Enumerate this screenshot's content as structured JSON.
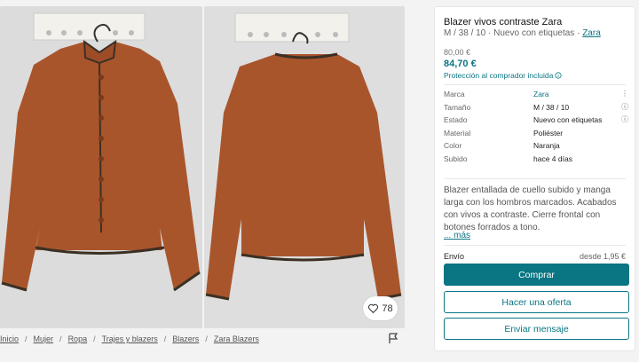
{
  "listing": {
    "title": "Blazer vivos contraste Zara",
    "subtitle": "M / 38 / 10 · Nuevo con etiquetas · ",
    "brand_link": "Zara",
    "old_price": "80,00 €",
    "price": "84,70 €",
    "protection": "Protección al comprador incluida"
  },
  "details": [
    {
      "key": "Marca",
      "value": "Zara",
      "link": true
    },
    {
      "key": "Tamaño",
      "value": "M / 38 / 10"
    },
    {
      "key": "Estado",
      "value": "Nuevo con etiquetas"
    },
    {
      "key": "Material",
      "value": "Poliéster"
    },
    {
      "key": "Color",
      "value": "Naranja"
    },
    {
      "key": "Subido",
      "value": "hace 4 días"
    }
  ],
  "description": "Blazer entallada de cuello subido y manga larga con los hombros marcados. Acabados con vivos a contraste. Cierre frontal con botones forrados a tono.",
  "more_link": "... más",
  "shipping": {
    "label": "Envío",
    "value": "desde 1,95 €"
  },
  "buttons": {
    "buy": "Comprar",
    "offer": "Hacer una oferta",
    "message": "Enviar mensaje"
  },
  "favorites": "78",
  "breadcrumbs": [
    "Inicio",
    "Mujer",
    "Ropa",
    "Trajes y blazers",
    "Blazers",
    "Zara Blazers"
  ],
  "colors": {
    "accent": "#0a7583",
    "jacket": "#a9552c"
  }
}
